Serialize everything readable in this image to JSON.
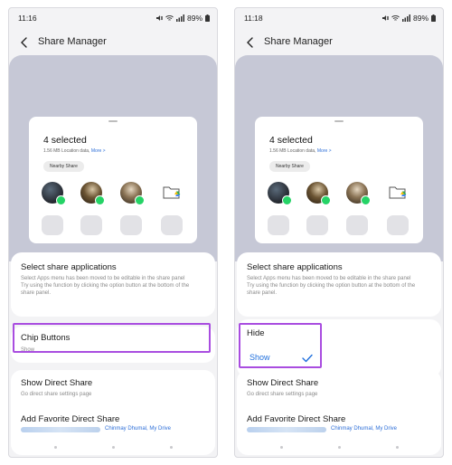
{
  "left": {
    "status": {
      "time": "11:16",
      "battery": "89%"
    },
    "header": {
      "title": "Share Manager"
    },
    "sheet": {
      "selected": "4 selected",
      "subtitle": "1.56 MB Location data,",
      "more": "More >",
      "chip": "Nearby Share"
    },
    "apps": {
      "title": "Select share applications",
      "description": "Select Apps menu has been moved to be editable in the share panel\nTry using the function by clicking the option button at the bottom of the share panel."
    },
    "chip_buttons": {
      "title": "Chip Buttons",
      "value": "Show"
    },
    "direct": {
      "show_title": "Show Direct Share",
      "show_sub": "Go direct share settings page",
      "fav_title": "Add Favorite Direct Share",
      "fav_sub": "Chinmay Dhumal, My Drive"
    }
  },
  "right": {
    "status": {
      "time": "11:18",
      "battery": "89%"
    },
    "header": {
      "title": "Share Manager"
    },
    "sheet": {
      "selected": "4 selected",
      "subtitle": "1.56 MB Location data,",
      "more": "More >",
      "chip": "Nearby Share"
    },
    "apps": {
      "title": "Select share applications",
      "description": "Select Apps menu has been moved to be editable in the share panel\nTry using the function by clicking the option button at the bottom of the share panel."
    },
    "chip_menu": {
      "hide": "Hide",
      "show": "Show"
    },
    "direct": {
      "show_title": "Show Direct Share",
      "show_sub": "Go direct share settings page",
      "fav_title": "Add Favorite Direct Share",
      "fav_sub": "Chinmay Dhumal, My Drive"
    }
  },
  "colors": {
    "highlight": "#a94de0",
    "accent": "#1f6fdd",
    "preview_bg": "#c6c8d6"
  },
  "icons": [
    "back-arrow-icon",
    "mute-icon",
    "wifi-icon",
    "signal-icon",
    "battery-icon",
    "whatsapp-icon",
    "folder-drive-icon",
    "check-icon"
  ]
}
